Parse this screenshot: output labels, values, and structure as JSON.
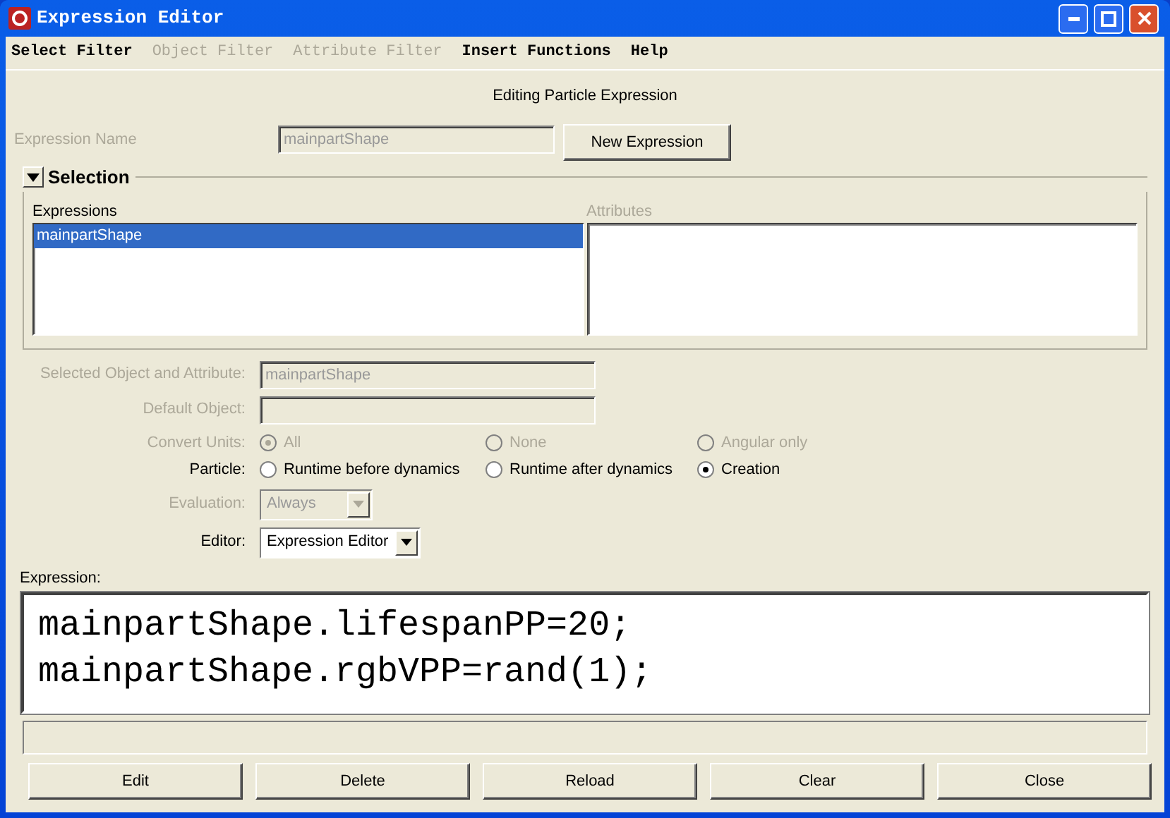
{
  "window": {
    "title": "Expression Editor"
  },
  "menu": [
    {
      "label": "Select Filter",
      "disabled": false
    },
    {
      "label": "Object Filter",
      "disabled": true
    },
    {
      "label": "Attribute Filter",
      "disabled": true
    },
    {
      "label": "Insert Functions",
      "disabled": false
    },
    {
      "label": "Help",
      "disabled": false
    }
  ],
  "header": "Editing Particle Expression",
  "expression_name": {
    "label": "Expression Name",
    "value": "mainpartShape",
    "disabled": true
  },
  "new_expression_button": "New Expression",
  "selection": {
    "title": "Selection",
    "expanded": true,
    "expressions": {
      "label": "Expressions",
      "items": [
        {
          "text": "mainpartShape",
          "selected": true
        }
      ]
    },
    "attributes": {
      "label": "Attributes",
      "disabled": true
    }
  },
  "fields": [
    {
      "label": "Selected Object and Attribute:",
      "value": "mainpartShape",
      "disabled": true
    },
    {
      "label": "Default Object:",
      "disabled": true
    }
  ],
  "radio_groups": [
    {
      "label": "Convert Units:",
      "disabled": true,
      "options": [
        {
          "label": "All",
          "selected": true
        },
        {
          "label": "None",
          "selected": false
        },
        {
          "label": "Angular only",
          "selected": false
        }
      ]
    },
    {
      "label": "Particle:",
      "disabled": false,
      "options": [
        {
          "label": "Runtime before dynamics",
          "selected": false
        },
        {
          "label": "Runtime after dynamics",
          "selected": false
        },
        {
          "label": "Creation",
          "selected": true
        }
      ]
    }
  ],
  "dropdowns": [
    {
      "label": "Evaluation:",
      "value": "Always",
      "disabled": true
    },
    {
      "label": "Editor:",
      "value": "Expression Editor",
      "disabled": false
    }
  ],
  "expression": {
    "label": "Expression:",
    "lines": [
      "mainpartShape.lifespanPP=20;",
      "mainpartShape.rgbVPP=rand(1);"
    ]
  },
  "buttons": [
    "Edit",
    "Delete",
    "Reload",
    "Clear",
    "Close"
  ]
}
